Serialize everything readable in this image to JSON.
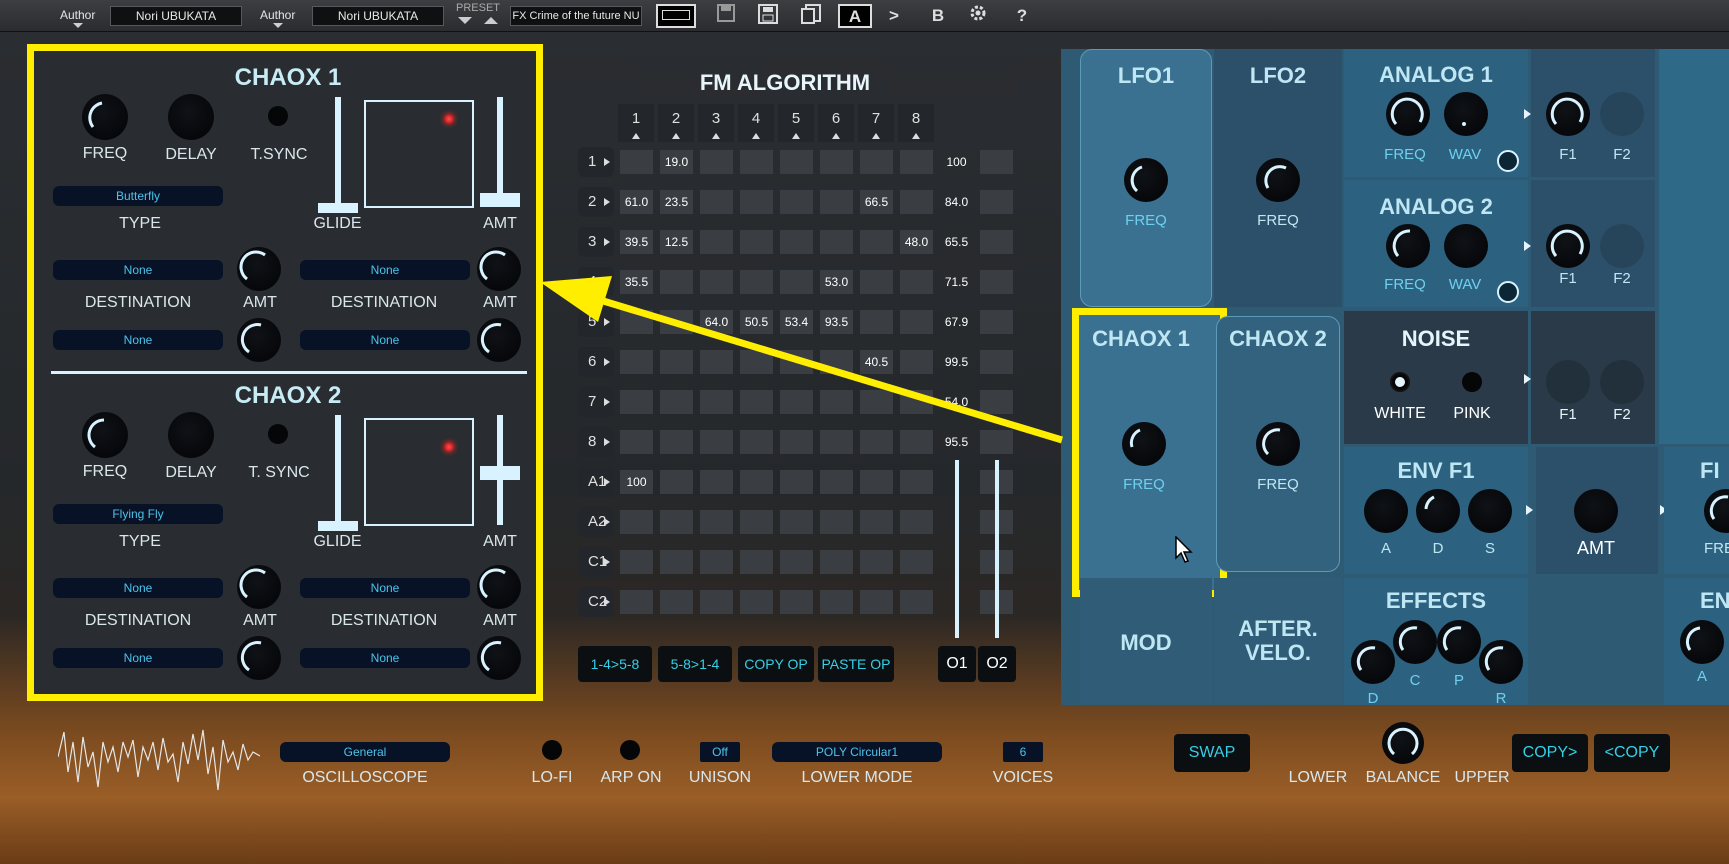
{
  "topbar": {
    "author_label": "Author",
    "author_value": "Nori UBUKATA",
    "author2_label": "Author",
    "author2_value": "Nori UBUKATA",
    "preset_label": "PRESET",
    "preset_name": "FX Crime of the future NU",
    "btn_a": "A",
    "btn_next": ">",
    "btn_b": "B",
    "btn_help": "?"
  },
  "chaox1": {
    "title": "CHAOX 1",
    "freq": "FREQ",
    "delay": "DELAY",
    "tsync": "T.SYNC",
    "type_value": "Butterfly",
    "type": "TYPE",
    "glide": "GLIDE",
    "amt": "AMT",
    "dest1": "None",
    "dest2": "None",
    "dest3": "None",
    "dest4": "None",
    "destination": "DESTINATION",
    "dest_amt": "AMT"
  },
  "chaox2": {
    "title": "CHAOX 2",
    "freq": "FREQ",
    "delay": "DELAY",
    "tsync": "T. SYNC",
    "type_value": "Flying Fly",
    "type": "TYPE",
    "glide": "GLIDE",
    "amt": "AMT",
    "dest1": "None",
    "dest2": "None",
    "dest3": "None",
    "dest4": "None",
    "destination": "DESTINATION",
    "dest_amt": "AMT"
  },
  "fm": {
    "title": "FM ALGORITHM",
    "cols": [
      "1",
      "2",
      "3",
      "4",
      "5",
      "6",
      "7",
      "8"
    ],
    "rows": [
      "1",
      "2",
      "3",
      "4",
      "5",
      "6",
      "7",
      "8",
      "A1",
      "A2",
      "C1",
      "C2"
    ],
    "cells": [
      [
        "",
        "19.0",
        "",
        "",
        "",
        "",
        "",
        ""
      ],
      [
        "61.0",
        "23.5",
        "",
        "",
        "",
        "",
        "66.5",
        ""
      ],
      [
        "39.5",
        "12.5",
        "",
        "",
        "",
        "",
        "",
        "48.0"
      ],
      [
        "35.5",
        "",
        "",
        "",
        "",
        "53.0",
        "",
        ""
      ],
      [
        "",
        "",
        "64.0",
        "50.5",
        "53.4",
        "93.5",
        "",
        ""
      ],
      [
        "",
        "",
        "",
        "",
        "",
        "",
        "40.5",
        ""
      ],
      [
        "",
        "",
        "",
        "",
        "",
        "",
        "",
        ""
      ],
      [
        "",
        "",
        "",
        "",
        "",
        "",
        "",
        ""
      ],
      [
        "100",
        "",
        "",
        "",
        "",
        "",
        "",
        ""
      ],
      [
        "",
        "",
        "",
        "",
        "",
        "",
        "",
        ""
      ],
      [
        "",
        "",
        "",
        "",
        "",
        "",
        "",
        ""
      ],
      [
        "",
        "",
        "",
        "",
        "",
        "",
        "",
        ""
      ]
    ],
    "out": [
      "100",
      "84.0",
      "65.5",
      "71.5",
      "67.9",
      "99.5",
      "54.0",
      "95.5",
      "",
      "",
      "",
      ""
    ],
    "btn1": "1-4>5-8",
    "btn2": "5-8>1-4",
    "btn3": "COPY OP",
    "btn4": "PASTE OP",
    "o1": "O1",
    "o2": "O2"
  },
  "right": {
    "lfo1": "LFO1",
    "lfo2": "LFO2",
    "freq": "FREQ",
    "analog1": "ANALOG 1",
    "analog2": "ANALOG 2",
    "wav": "WAV",
    "f1": "F1",
    "f2": "F2",
    "chaox1": "CHAOX 1",
    "chaox2": "CHAOX 2",
    "noise": "NOISE",
    "white": "WHITE",
    "pink": "PINK",
    "envf1": "ENV F1",
    "a": "A",
    "d": "D",
    "s": "S",
    "amt": "AMT",
    "fi": "FI",
    "fre": "FRE",
    "effects": "EFFECTS",
    "c": "C",
    "p": "P",
    "r": "R",
    "mod": "MOD",
    "after1": "AFTER.",
    "after2": "VELO.",
    "en": "EN"
  },
  "bottom": {
    "osc_value": "General",
    "oscilloscope": "OSCILLOSCOPE",
    "lofi": "LO-FI",
    "arpon": "ARP ON",
    "unison_value": "Off",
    "unison": "UNISON",
    "mode_value": "POLY Circular1",
    "lower_mode": "LOWER MODE",
    "voices_value": "6",
    "voices": "VOICES",
    "swap": "SWAP",
    "lower": "LOWER",
    "balance": "BALANCE",
    "upper": "UPPER",
    "copy_r": "COPY>",
    "copy_l": "<COPY"
  },
  "colors": {
    "highlight": "#ffee00",
    "accent": "#35cfe6",
    "panel": "#2b5c78"
  }
}
